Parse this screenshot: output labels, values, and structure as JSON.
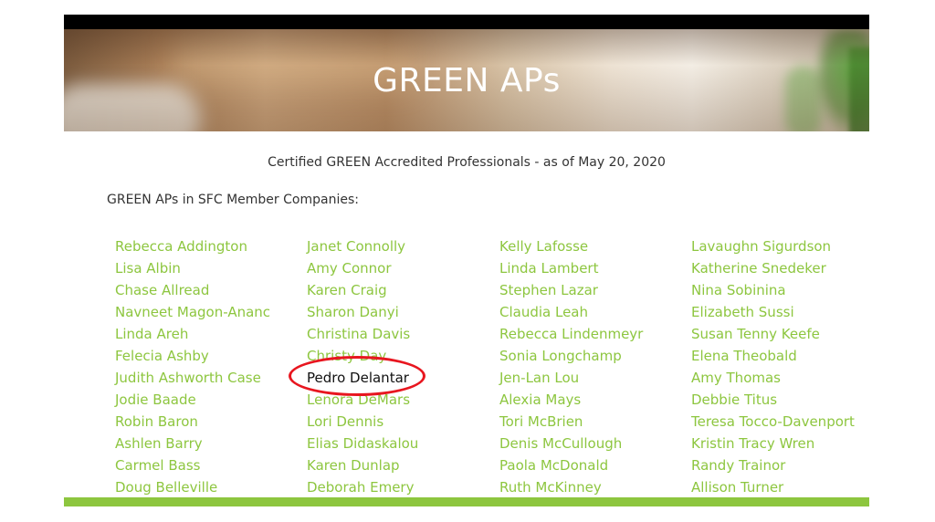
{
  "header": {
    "title": "GREEN APs"
  },
  "subtitle": "Certified GREEN Accredited Professionals - as of May 20, 2020",
  "section_heading": "GREEN APs in SFC Member Companies:",
  "highlighted_name": "Pedro Delantar",
  "colors": {
    "link_green": "#8dc63f",
    "highlight_circle": "#e8161f",
    "text": "#333333"
  },
  "columns": [
    [
      "Rebecca Addington",
      "Lisa Albin",
      "Chase Allread",
      "Navneet Magon-Ananc",
      "Linda Areh",
      "Felecia Ashby",
      "Judith Ashworth Case",
      "Jodie Baade",
      "Robin Baron",
      "Ashlen Barry",
      "Carmel Bass",
      "Doug Belleville"
    ],
    [
      "Janet Connolly",
      "Amy Connor",
      "Karen Craig",
      "Sharon Danyi",
      "Christina Davis",
      "Christy Day",
      "Pedro Delantar",
      "Lenora DeMars",
      "Lori Dennis",
      "Elias Didaskalou",
      "Karen Dunlap",
      "Deborah Emery"
    ],
    [
      "Kelly Lafosse",
      "Linda Lambert",
      "Stephen Lazar",
      "Claudia Leah",
      "Rebecca Lindenmeyr",
      "Sonia Longchamp",
      "Jen-Lan Lou",
      "Alexia Mays",
      "Tori McBrien",
      "Denis McCullough",
      "Paola McDonald",
      "Ruth McKinney"
    ],
    [
      "Lavaughn Sigurdson",
      "Katherine Snedeker",
      "Nina Sobinina",
      "Elizabeth Sussi",
      "Susan Tenny Keefe",
      "Elena Theobald",
      "Amy Thomas",
      "Debbie Titus",
      "Teresa Tocco-Davenport",
      "Kristin Tracy Wren",
      "Randy Trainor",
      "Allison Turner"
    ]
  ]
}
